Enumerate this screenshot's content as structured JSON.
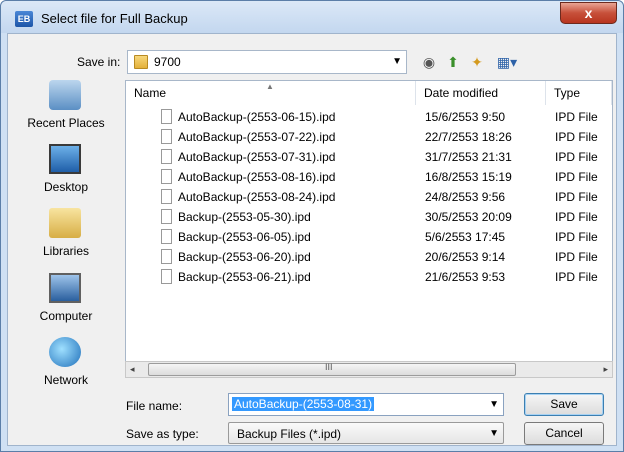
{
  "window": {
    "title": "Select file for Full Backup",
    "app_icon": "EB"
  },
  "titlebar": {
    "close_glyph": "x"
  },
  "save_in": {
    "label": "Save in:",
    "value": "9700"
  },
  "toolbar": {
    "back_icon": "◉",
    "up_icon": "⬆",
    "new_folder_icon": "✦",
    "view_icon": "▦▾"
  },
  "places": [
    {
      "label": "Recent Places",
      "icon": "recent-places-icon"
    },
    {
      "label": "Desktop",
      "icon": "desktop-icon"
    },
    {
      "label": "Libraries",
      "icon": "libraries-icon"
    },
    {
      "label": "Computer",
      "icon": "computer-icon"
    },
    {
      "label": "Network",
      "icon": "network-icon"
    }
  ],
  "columns": {
    "name": "Name",
    "date": "Date modified",
    "type": "Type"
  },
  "files": [
    {
      "name": "AutoBackup-(2553-06-15).ipd",
      "date": "15/6/2553 9:50",
      "type": "IPD File"
    },
    {
      "name": "AutoBackup-(2553-07-22).ipd",
      "date": "22/7/2553 18:26",
      "type": "IPD File"
    },
    {
      "name": "AutoBackup-(2553-07-31).ipd",
      "date": "31/7/2553 21:31",
      "type": "IPD File"
    },
    {
      "name": "AutoBackup-(2553-08-16).ipd",
      "date": "16/8/2553 15:19",
      "type": "IPD File"
    },
    {
      "name": "AutoBackup-(2553-08-24).ipd",
      "date": "24/8/2553 9:56",
      "type": "IPD File"
    },
    {
      "name": "Backup-(2553-05-30).ipd",
      "date": "30/5/2553 20:09",
      "type": "IPD File"
    },
    {
      "name": "Backup-(2553-06-05).ipd",
      "date": "5/6/2553 17:45",
      "type": "IPD File"
    },
    {
      "name": "Backup-(2553-06-20).ipd",
      "date": "20/6/2553 9:14",
      "type": "IPD File"
    },
    {
      "name": "Backup-(2553-06-21).ipd",
      "date": "21/6/2553 9:53",
      "type": "IPD File"
    }
  ],
  "scrollbar": {
    "left_glyph": "◂",
    "right_glyph": "▸",
    "grip_glyph": "III"
  },
  "file_name": {
    "label": "File name:",
    "value": "AutoBackup-(2553-08-31)"
  },
  "save_as_type": {
    "label": "Save as type:",
    "value": "Backup Files (*.ipd)"
  },
  "buttons": {
    "save": "Save",
    "cancel": "Cancel"
  },
  "dropdown_glyph": "▼"
}
